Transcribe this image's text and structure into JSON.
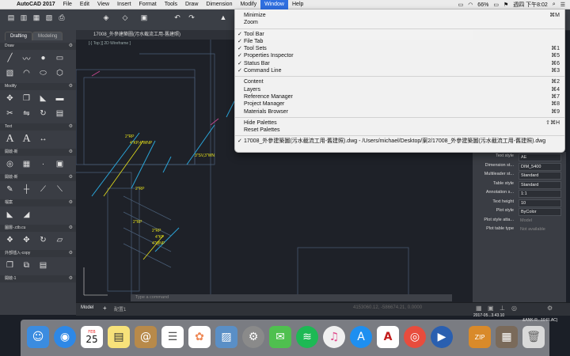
{
  "menubar": {
    "app_name": "AutoCAD 2017",
    "items": [
      "File",
      "Edit",
      "View",
      "Insert",
      "Format",
      "Tools",
      "Draw",
      "Dimension",
      "Modify",
      "Window",
      "Help"
    ],
    "active_item": "Window",
    "battery": "66%",
    "clock": "週四 下午8:02"
  },
  "palette": {
    "tabs": [
      "Drafting",
      "Modeling"
    ],
    "sections": [
      {
        "label": "Draw"
      },
      {
        "label": "Modify"
      },
      {
        "label": "Text"
      },
      {
        "label": "開啟-新"
      },
      {
        "label": "開啟-新"
      },
      {
        "label": "檔案"
      },
      {
        "label": "圖層-.ctb.cu"
      },
      {
        "label": "外部插入-copy"
      },
      {
        "label": "開啟-1"
      }
    ]
  },
  "document": {
    "tab_title": "17008_外參建築圖(污水截流工用-舊建照)",
    "viewport_label": "[-] Top ][ 2D Wireframe ]"
  },
  "window_menu": {
    "group1": [
      {
        "label": "Minimize",
        "shortcut": "⌘M"
      },
      {
        "label": "Zoom",
        "shortcut": ""
      }
    ],
    "group2": [
      {
        "label": "Tool Bar",
        "shortcut": "",
        "checked": true
      },
      {
        "label": "File Tab",
        "shortcut": "",
        "checked": true
      },
      {
        "label": "Tool Sets",
        "shortcut": "⌘1",
        "checked": true
      },
      {
        "label": "Properties Inspector",
        "shortcut": "⌘5",
        "checked": true
      },
      {
        "label": "Status Bar",
        "shortcut": "⌘6",
        "checked": true
      },
      {
        "label": "Command Line",
        "shortcut": "⌘3",
        "checked": true
      }
    ],
    "group3": [
      {
        "label": "Content",
        "shortcut": "⌘2"
      },
      {
        "label": "Layers",
        "shortcut": "⌘4"
      },
      {
        "label": "Reference Manager",
        "shortcut": "⌘7"
      },
      {
        "label": "Project Manager",
        "shortcut": "⌘8"
      },
      {
        "label": "Materials Browser",
        "shortcut": "⌘9"
      }
    ],
    "group4": [
      {
        "label": "Hide Palettes",
        "shortcut": "⇧⌘H"
      },
      {
        "label": "Reset Palettes",
        "shortcut": ""
      }
    ],
    "open_file": "17008_外參建築圖(污水截流工用-舊建照).dwg - /Users/michael/Desktop/案2/17008_外參建築圖(污水截流工用-舊建照).dwg"
  },
  "properties": [
    {
      "label": "Text style",
      "value": "AE"
    },
    {
      "label": "Dimension st...",
      "value": "DIM_5400"
    },
    {
      "label": "Multileader st...",
      "value": "Standard"
    },
    {
      "label": "Table style",
      "value": "Standard"
    },
    {
      "label": "Annotation s...",
      "value": "1:1"
    },
    {
      "label": "Text height",
      "value": "10"
    },
    {
      "label": "Plot style",
      "value": "ByColor"
    },
    {
      "label": "Plot style atta...",
      "value": "Model",
      "dim": true
    },
    {
      "label": "Plot table type",
      "value": "Not available",
      "dim": true
    }
  ],
  "annotations": [
    "2\"RP",
    "4\"KP,4\"WNP",
    "3\"SV,3\"WN",
    "2\"RP",
    "2\"RP",
    "2\"RP",
    "4\"KP",
    "4\"WNP"
  ],
  "status": {
    "model_tab": "Model",
    "layout_tab": "配置1",
    "command_placeholder": "Type a command",
    "coords": "4153060.12, -586674.21, 0.0000"
  },
  "desktop_labels": {
    "date": "2017-05...3.43.10",
    "file": "&ANK-R...10 FLAC)"
  },
  "dock": {
    "calendar_month": "FEB",
    "calendar_day": "25",
    "items": [
      "Finder",
      "Safari",
      "Calendar",
      "Notes",
      "Contacts",
      "Reminders",
      "Photos",
      "Preview",
      "System Preferences",
      "Messages",
      "Spotify",
      "iTunes",
      "App Store",
      "AutoCAD",
      "Chrome",
      "QuickTime",
      "Archive",
      "Desktop",
      "Trash"
    ]
  },
  "colors": {
    "accent": "#2f6fe0",
    "canvas": "#1e2128",
    "cyan_line": "#2aa4d8",
    "yellow_text": "#e6e01a"
  }
}
